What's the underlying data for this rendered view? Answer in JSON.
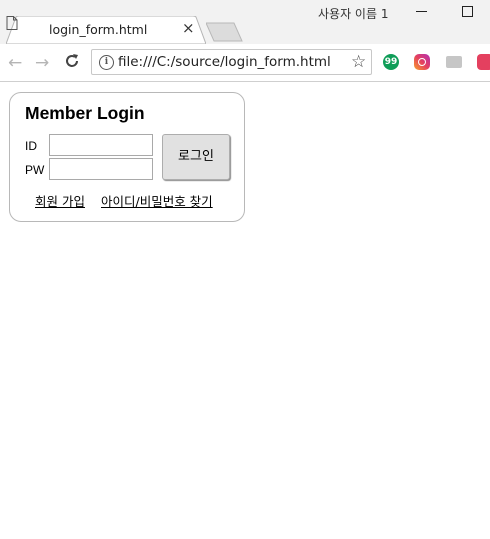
{
  "window": {
    "user_label": "사용자 이름 1"
  },
  "tab": {
    "title": "login_form.html",
    "close_glyph": "×",
    "icon": "document-icon"
  },
  "toolbar": {
    "back_glyph": "←",
    "forward_glyph": "→",
    "address": "file:///C:/source/login_form.html",
    "info_glyph": "i",
    "star_glyph": "☆",
    "extensions": [
      "hangouts-icon",
      "instagram-icon",
      "chat-extension-icon",
      "pocket-icon"
    ],
    "ext1_glyph": "99"
  },
  "login": {
    "title": "Member Login",
    "id_label": "ID",
    "pw_label": "PW",
    "id_value": "",
    "pw_value": "",
    "button_label": "로그인",
    "join_link": "회원 가입",
    "find_link": "아이디/비밀번호 찾기"
  },
  "colors": {
    "titlebar": "#f2f2f2",
    "box_border": "#b8b8b8",
    "button_bg": "#e1e1e1"
  }
}
